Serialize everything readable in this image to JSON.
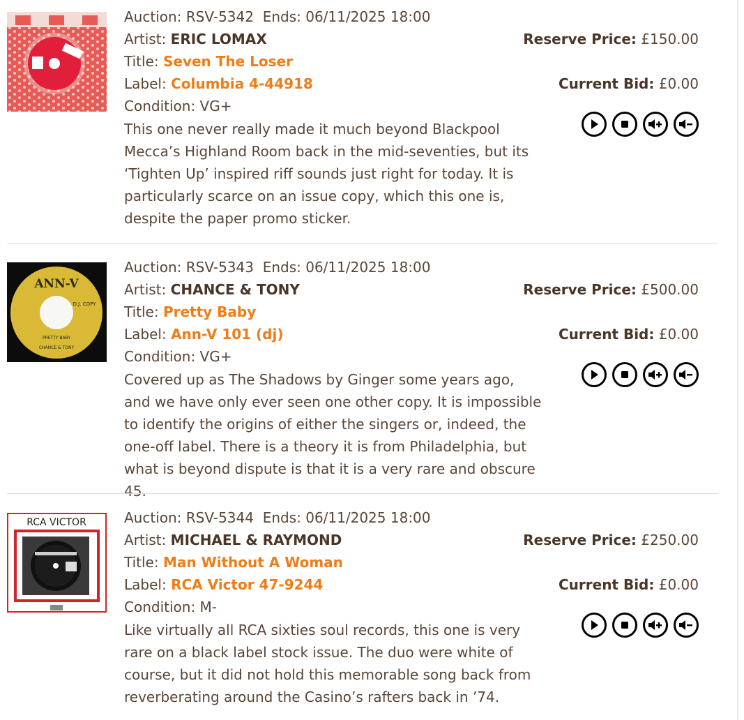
{
  "lots": [
    {
      "auction_label": "Auction:",
      "auction_id": "RSV-5342",
      "ends_label": "Ends:",
      "ends": "06/11/2025 18:00",
      "artist_label": "Artist:",
      "artist": "ERIC LOMAX",
      "title_label": "Title:",
      "title": "Seven The Loser",
      "label_label": "Label:",
      "label": "Columbia 4-44918",
      "condition_label": "Condition:",
      "condition": "VG+",
      "description": "This one never really made it much beyond Blackpool Mecca’s Highland Room back in the mid-seventies, but its ‘Tighten Up’ inspired riff sounds just right for today. It is particularly scarce on an issue copy, which this one is, despite the paper promo sticker.",
      "reserve_label": "Reserve Price:",
      "reserve": "£150.00",
      "bid_label": "Current Bid:",
      "bid": "£0.00"
    },
    {
      "auction_label": "Auction:",
      "auction_id": "RSV-5343",
      "ends_label": "Ends:",
      "ends": "06/11/2025 18:00",
      "artist_label": "Artist:",
      "artist": "CHANCE & TONY",
      "title_label": "Title:",
      "title": "Pretty Baby",
      "label_label": "Label:",
      "label": "Ann-V 101 (dj)",
      "condition_label": "Condition:",
      "condition": "VG+",
      "description": "Covered up as The Shadows by Ginger some years ago, and we have only ever seen one other copy. It is impossible to identify the origins of either the singers or, indeed, the one-off label. There is a theory it is from Philadelphia, but what is beyond dispute is that it is a very rare and obscure 45.",
      "reserve_label": "Reserve Price:",
      "reserve": "£500.00",
      "bid_label": "Current Bid:",
      "bid": "£0.00",
      "thumb_text": {
        "brand": "ANN-V",
        "dj": "D.J. COPY",
        "song": "PRETTY BABY",
        "artist": "CHANCE & TONY"
      }
    },
    {
      "auction_label": "Auction:",
      "auction_id": "RSV-5344",
      "ends_label": "Ends:",
      "ends": "06/11/2025 18:00",
      "artist_label": "Artist:",
      "artist": "MICHAEL & RAYMOND",
      "title_label": "Title:",
      "title": "Man Without A Woman",
      "label_label": "Label:",
      "label": "RCA Victor 47-9244",
      "condition_label": "Condition:",
      "condition": "M-",
      "description": "Like virtually all RCA sixties soul records, this one is very rare on a black label stock issue. The duo were white of course, but it did not hold this memorable song back from reverberating around the Casino’s rafters back in ’74.",
      "reserve_label": "Reserve Price:",
      "reserve": "£250.00",
      "bid_label": "Current Bid:",
      "bid": "£0.00",
      "thumb_text": {
        "brand": "RCA VICTOR"
      }
    }
  ],
  "player_icons": [
    "play-icon",
    "stop-icon",
    "volume-up-icon",
    "volume-down-icon"
  ],
  "colors": {
    "text": "#5a4536",
    "accent": "#ef7d17"
  }
}
